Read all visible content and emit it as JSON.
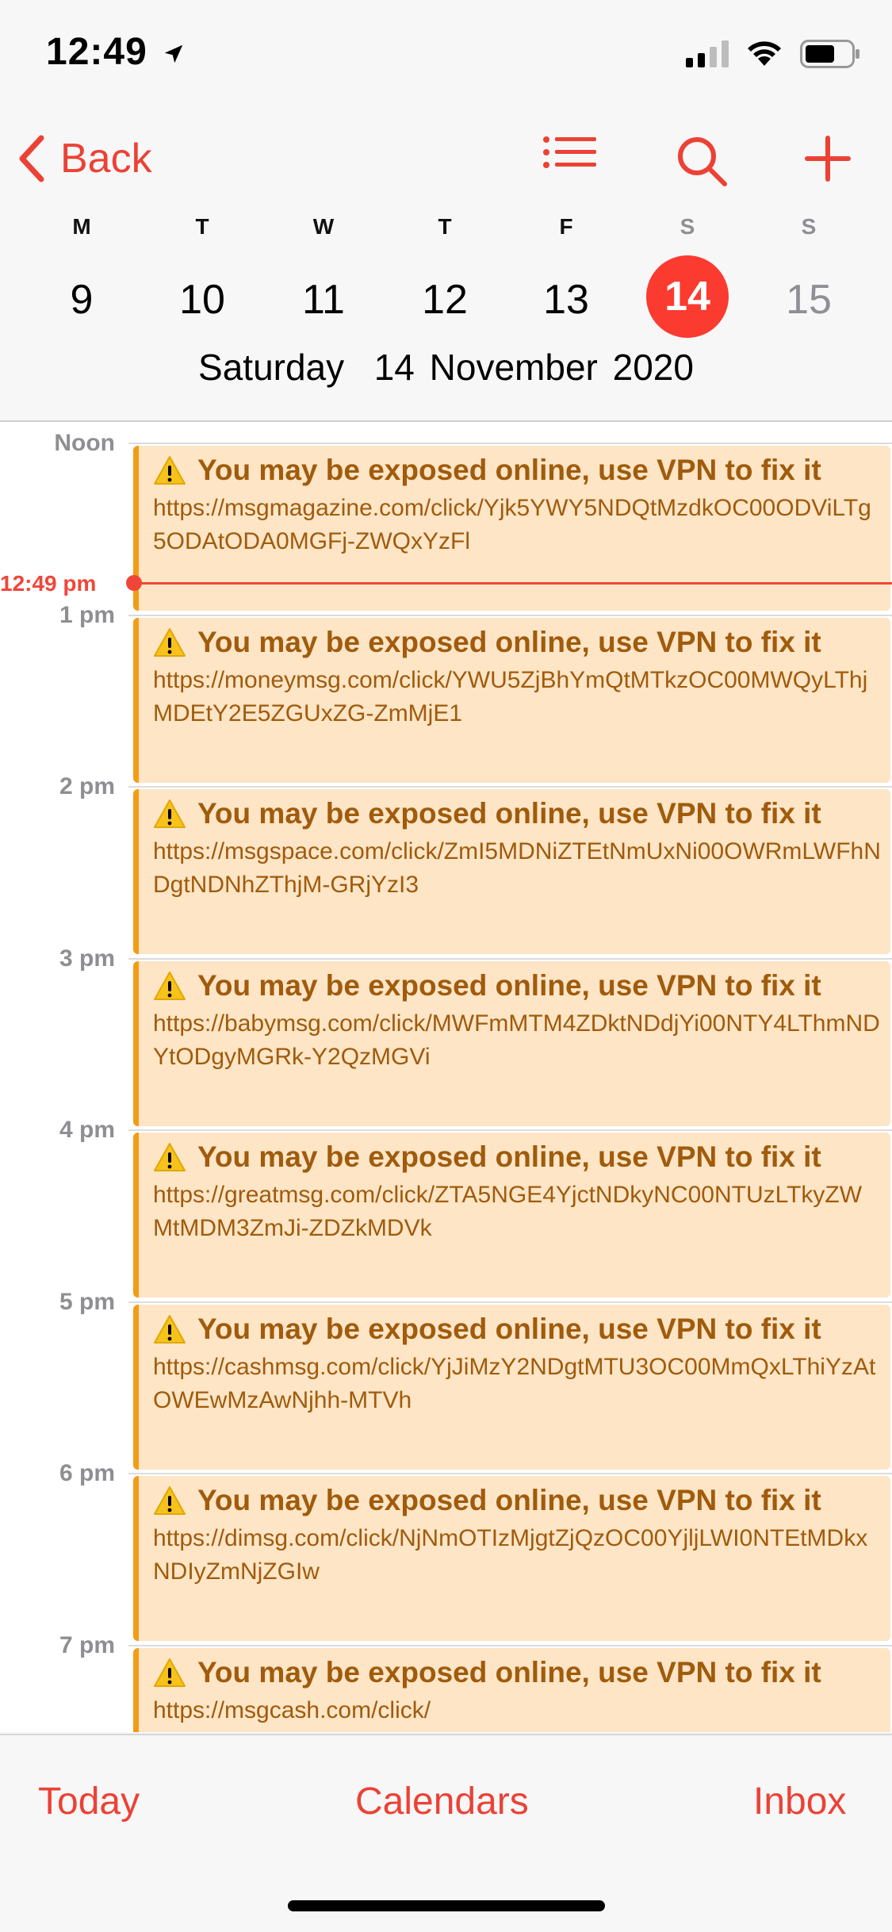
{
  "status_bar": {
    "time": "12:49"
  },
  "nav": {
    "back_label": "Back"
  },
  "week": [
    {
      "letter": "M",
      "number": "9"
    },
    {
      "letter": "T",
      "number": "10"
    },
    {
      "letter": "W",
      "number": "11"
    },
    {
      "letter": "T",
      "number": "12"
    },
    {
      "letter": "F",
      "number": "13"
    },
    {
      "letter": "S",
      "number": "14"
    },
    {
      "letter": "S",
      "number": "15"
    }
  ],
  "selected_day": "14",
  "date_title": "Saturday  14 November 2020",
  "hours": [
    "Noon",
    "1 pm",
    "2 pm",
    "3 pm",
    "4 pm",
    "5 pm",
    "6 pm",
    "7 pm"
  ],
  "now_label": "12:49 pm",
  "events": [
    {
      "title": "You may be exposed online, use VPN to fix it",
      "url": "https://msgmagazine.com/click/Yjk5YWY5NDQtMzdkOC00ODViLTg5ODAtODA0MGFj-ZWQxYzFl"
    },
    {
      "title": "You may be exposed online, use VPN to fix it",
      "url": "https://moneymsg.com/click/YWU5ZjBhYmQtMTkzOC00MWQyLThjMDEtY2E5ZGUxZG-ZmMjE1"
    },
    {
      "title": "You may be exposed online, use VPN to fix it",
      "url": "https://msgspace.com/click/ZmI5MDNiZTEtNmUxNi00OWRmLWFhNDgtNDNhZThjM-GRjYzI3"
    },
    {
      "title": "You may be exposed online, use VPN to fix it",
      "url": "https://babymsg.com/click/MWFmMTM4ZDktNDdjYi00NTY4LThmNDYtODgyMGRk-Y2QzMGVi"
    },
    {
      "title": "You may be exposed online, use VPN to fix it",
      "url": "https://greatmsg.com/click/ZTA5NGE4YjctNDkyNC00NTUzLTkyZWMtMDM3ZmJi-ZDZkMDVk"
    },
    {
      "title": "You may be exposed online, use VPN to fix it",
      "url": "https://cashmsg.com/click/YjJiMzY2NDgtMTU3OC00MmQxLThiYzAtOWEwMzAwNjhh-MTVh"
    },
    {
      "title": "You may be exposed online, use VPN to fix it",
      "url": "https://dimsg.com/click/NjNmOTIzMjgtZjQzOC00YjljLWI0NTEtMDkxNDIyZmNjZGIw"
    },
    {
      "title": "You may be exposed online, use VPN to fix it",
      "url": "https://msgcash.com/click/"
    }
  ],
  "tab_bar": {
    "today": "Today",
    "calendars": "Calendars",
    "inbox": "Inbox"
  },
  "colors": {
    "accent": "#eb4235",
    "event_bg": "#fde5c6",
    "event_border": "#f49b16",
    "event_text": "#a05b0c"
  }
}
